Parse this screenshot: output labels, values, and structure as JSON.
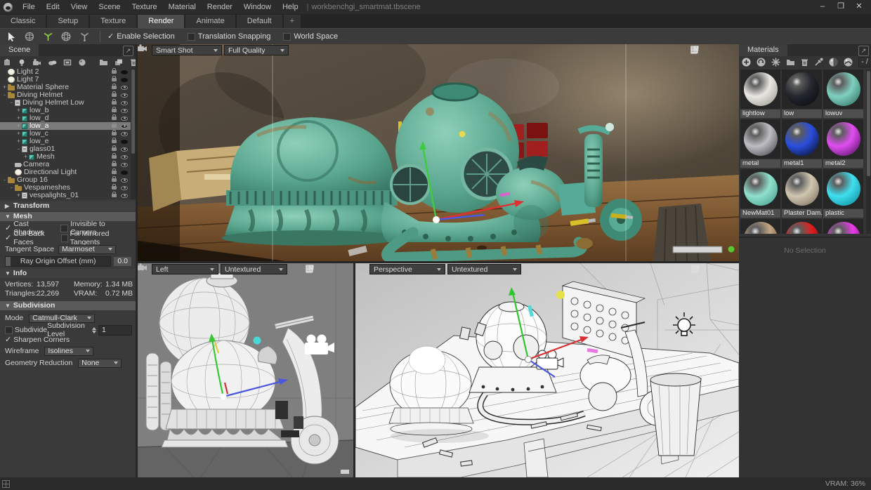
{
  "window": {
    "menu_items": [
      "File",
      "Edit",
      "View",
      "Scene",
      "Texture",
      "Material",
      "Render",
      "Window",
      "Help"
    ],
    "separator": "|",
    "document": "workbenchgi_smartmat.tbscene",
    "controls": {
      "minimize": "–",
      "restore": "❐",
      "close": "✕"
    }
  },
  "tab_bar": {
    "tabs": [
      "Classic",
      "Setup",
      "Texture",
      "Render",
      "Animate",
      "Default"
    ],
    "active_tab": "Render",
    "add_tab": "+"
  },
  "toolbar": {
    "checks": [
      {
        "label": "Enable Selection",
        "checked": true
      },
      {
        "label": "Translation Snapping",
        "checked": false
      },
      {
        "label": "World Space",
        "checked": false
      }
    ],
    "check_glyph": "✓"
  },
  "scene_panel": {
    "title": "Scene",
    "tree": [
      {
        "label": "Light 2",
        "icon": "light",
        "expander": "",
        "eye": "closed"
      },
      {
        "label": "Light 7",
        "icon": "light",
        "expander": "",
        "eye": "closed"
      },
      {
        "label": "Material Sphere",
        "icon": "folder",
        "expander": "+",
        "eye": "open"
      },
      {
        "label": "Diving Helmet",
        "icon": "folder",
        "expander": "-",
        "eye": "open"
      },
      {
        "label": "Diving Helmet Low",
        "icon": "meshdoc",
        "expander": "-",
        "eye": "open"
      },
      {
        "label": "low_b",
        "icon": "mesh",
        "expander": "+",
        "eye": "open"
      },
      {
        "label": "low_d",
        "icon": "mesh",
        "expander": "+",
        "eye": "open"
      },
      {
        "label": "low_a",
        "icon": "mesh",
        "expander": "+",
        "eye": "open",
        "selected": true
      },
      {
        "label": "low_c",
        "icon": "mesh",
        "expander": "+",
        "eye": "open"
      },
      {
        "label": "low_e",
        "icon": "mesh",
        "expander": "+",
        "eye": "closed"
      },
      {
        "label": "glass01",
        "icon": "meshdoc",
        "expander": "-",
        "eye": "open"
      },
      {
        "label": "Mesh",
        "icon": "mesh",
        "expander": "+",
        "eye": "open"
      },
      {
        "label": "Camera",
        "icon": "camera",
        "expander": "",
        "eye": "open"
      },
      {
        "label": "Directional Light",
        "icon": "light",
        "expander": "",
        "eye": "closed"
      },
      {
        "label": "Group 16",
        "icon": "folder",
        "expander": "-",
        "eye": "open"
      },
      {
        "label": "Vespameshes",
        "icon": "folder",
        "expander": "-",
        "eye": "open"
      },
      {
        "label": "vespalights_01",
        "icon": "meshdoc",
        "expander": "+",
        "eye": "open"
      }
    ]
  },
  "transform_panel": {
    "title": "Transform",
    "collapsed_arrow": "▶"
  },
  "mesh_panel": {
    "title": "Mesh",
    "expanded_arrow": "▼",
    "cast_shadows": "Cast Shadows",
    "invisible_to_camera": "Invisible to Camera",
    "cull_back_faces": "Cull Back Faces",
    "fix_mirrored_tangents": "Fix Mirrored Tangents",
    "tangent_space_label": "Tangent Space",
    "tangent_space_value": "Marmoset",
    "ray_origin_label": "Ray Origin Offset (mm)",
    "ray_origin_value": "0.0"
  },
  "info_panel": {
    "title": "Info",
    "vertices_label": "Vertices:",
    "vertices": "13,597",
    "triangles_label": "Triangles:",
    "triangles": "22,269",
    "memory_label": "Memory:",
    "memory": "1.34 MB",
    "vram_label": "VRAM:",
    "vram": "0.72 MB"
  },
  "subdivision_panel": {
    "title": "Subdivision",
    "mode_label": "Mode",
    "mode_value": "Catmull-Clark",
    "subdivide_label": "Subdivide",
    "level_label": "Subdivision Level",
    "level_value": "1",
    "sharpen_label": "Sharpen Corners",
    "wireframe_label": "Wireframe",
    "wireframe_value": "Isolines",
    "reduction_label": "Geometry Reduction",
    "reduction_value": "None"
  },
  "viewports": {
    "main": {
      "camera": "Smart Shot",
      "quality": "Full Quality"
    },
    "left": {
      "camera": "Left",
      "shading": "Untextured"
    },
    "perspective": {
      "camera": "Perspective",
      "shading": "Untextured"
    }
  },
  "materials_panel": {
    "title": "Materials",
    "counter": "- /",
    "no_selection": "No Selection",
    "items": [
      {
        "name": "lightlow",
        "color": "#e9e7e2",
        "dark": "#8f8d85"
      },
      {
        "name": "low",
        "color": "#23272e",
        "dark": "#04060a"
      },
      {
        "name": "lowuv",
        "color": "#7fd0c0",
        "dark": "#2a6356"
      },
      {
        "name": "metal",
        "color": "#bdbdc2",
        "dark": "#37373e"
      },
      {
        "name": "metal1",
        "color": "#2a4ede",
        "dark": "#05070f"
      },
      {
        "name": "metal2",
        "color": "#e14df2",
        "dark": "#3c0a48"
      },
      {
        "name": "NewMat01",
        "color": "#8fe0cc",
        "dark": "#3d9784"
      },
      {
        "name": "Plaster Dam...",
        "color": "#d1c6b0",
        "dark": "#6f6654"
      },
      {
        "name": "plastic",
        "color": "#3fe0ef",
        "dark": "#0b7f93"
      },
      {
        "name": "",
        "color": "#c4a584",
        "dark": "#5e441f"
      },
      {
        "name": "",
        "color": "#e01f1f",
        "dark": "#520404"
      },
      {
        "name": "",
        "color": "#ea3cea",
        "dark": "#5d075d"
      }
    ]
  },
  "status_bar": {
    "vram": "VRAM: 36%"
  },
  "accents": {
    "gizmo_green": "#3ecb3e",
    "gizmo_red": "#e03030",
    "gizmo_blue": "#4a58e8",
    "verdigris": "#58ab95",
    "tool_active_green": "#8dc63f"
  }
}
